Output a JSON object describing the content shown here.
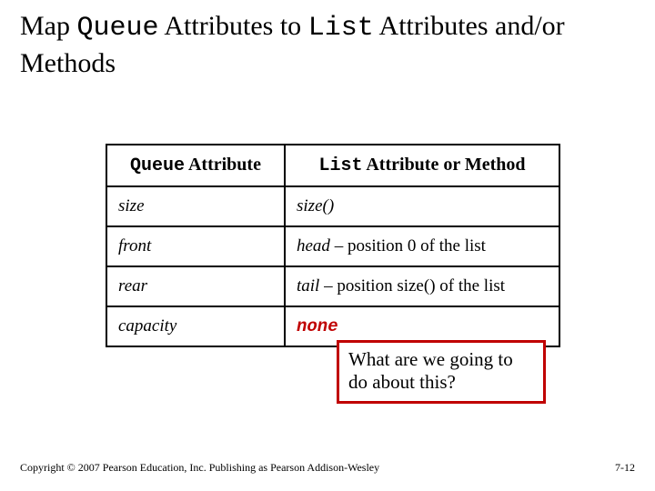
{
  "title": {
    "part1": "Map ",
    "code1": "Queue",
    "part2": " Attributes to ",
    "code2": "List",
    "part3": " Attributes and/or Methods"
  },
  "table": {
    "header": {
      "col1_code": "Queue",
      "col1_rest": " Attribute",
      "col2_code": "List",
      "col2_rest": " Attribute or Method"
    },
    "rows": [
      {
        "attr": "size",
        "val_ital": "size()",
        "val_rest": ""
      },
      {
        "attr": "front",
        "val_ital": "head",
        "val_rest": " – position 0 of the list"
      },
      {
        "attr": "rear",
        "val_ital": "tail",
        "val_rest": " – position size() of the list"
      },
      {
        "attr": "capacity",
        "val_none": "none",
        "val_rest": ""
      }
    ]
  },
  "callout": "What are we going to do about this?",
  "footer": {
    "copyright": "Copyright © 2007 Pearson Education, Inc. Publishing as Pearson Addison-Wesley",
    "page": "7-12"
  }
}
